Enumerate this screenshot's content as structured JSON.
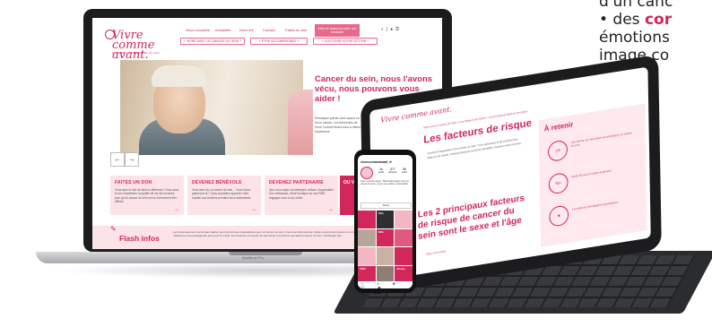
{
  "cropped_text": {
    "line1": "d'un canc",
    "line2_prefix": "• des ",
    "line2_bold": "cor",
    "line3": "émotions",
    "line4": "image co"
  },
  "laptop": {
    "brand_label": "MacBook Pro",
    "site": {
      "logo_title": "Vivre comme avant.",
      "logo_tagline": "Ensemble contre le cancer du sein",
      "nav": [
        "Nous connaître",
        "Actualités",
        "Nous lire",
        "Contact",
        "Faites un don"
      ],
      "nav_cta": "Vivre en ressource avec une bénévole",
      "subnav": [
        "+ VIVRE AVEC LE CANCER DU SEIN +",
        "+ ÊTRE ACCOMPAGNÉE +",
        "+ SOUTENIR NOTRE ACTION +"
      ],
      "hero_title": "Cancer du sein, nous l'avons vécu, nous pouvons vous aider !",
      "hero_text": "Remarque parfois dure quand on vit un cancer. Les bénévoles de Vivre Comme Avant vous à même expérience",
      "prev_arrow": "←",
      "next_arrow": "→",
      "cards": [
        {
          "title": "FAITES UN DON",
          "text": "Vous avez le don de faire la différence ! Vous avez le don d'améliorer la qualité de vie des femmes pour qui le cancer du sein est un événement très difficile."
        },
        {
          "title": "DEVENEZ BÉNÉVOLE",
          "text": "Vous avez eu un cancer du sein… Vous l'avez passé par là ? Vous souhaitez apporter votre soutien aux femmes pendant leurs traitements."
        },
        {
          "title": "DEVENEZ PARTENAIRE",
          "text": "Que vous soyez commerçant, artisan, responsable d'un restaurant, d'une boutique ou une PME, engagez-vous à nos côtés."
        }
      ],
      "card_arrow": "→",
      "card_pink_title": "OU V",
      "flash_title": "Flash infos",
      "flash_text": "Les bénévoles sont reconnues viables pour les femmes hospitalisées pour un cancer du sein. C'est une belle journée ! Elles ouvrent leurs parents et vous pour les médecins et les enseignants pour pour le Covid. Les femmes ont besoin de rencontrer une femme qui avait le cancer du sein, d'échanger leur."
    }
  },
  "tablet": {
    "logo": "Vivre comme avant.",
    "breadcrumb": "Vivre avec le cancer du sein  >  Les facteurs de risque  >  Les principaux facteurs de risque",
    "title": "Les facteurs de risque",
    "body": "Comment l'apparition d'un cancer du sein ? Ces questions et de nombreuses facteurs de risque. Certains facteurs sont bien identifiés, d'autres moins connus.",
    "h2": "Les 2 principaux facteurs de risque de cancer du sein sont le sexe et l'âge",
    "retenir_title": "À retenir",
    "retenir_items": [
      {
        "badge": "1/8",
        "text": "Une femme sur huit risque de développer un cancer du sein"
      },
      {
        "badge": "50+",
        "text": "Après 50 ans, le risque augmente"
      },
      {
        "badge": "✱",
        "text": "Les facteurs héréditaires et génétiques"
      }
    ],
    "bullet": "• Être une femme"
  },
  "phone": {
    "username": "vivrecommeavant_fr",
    "stats": [
      {
        "value": "1k",
        "label": "posts"
      },
      {
        "value": "577",
        "label": "abonnés"
      },
      {
        "value": "85",
        "label": "suivis"
      }
    ],
    "bio": "Vivre Comme Avant · Bénévoles ayant vécu un cancer du sein, nous vous aidons. Association",
    "button": "Suivre",
    "tiles": [
      {
        "text": "",
        "color": "#d2275a"
      },
      {
        "text": "40%",
        "color": "#2f2f33"
      },
      {
        "text": "",
        "color": "#f3b6c3"
      },
      {
        "text": "",
        "color": "#b7a59a"
      },
      {
        "text": "60%",
        "color": "#d2275a"
      },
      {
        "text": "",
        "color": "#e05a7f"
      },
      {
        "text": "",
        "color": "#f3b6c3"
      },
      {
        "text": "",
        "color": "#c9b2a4"
      },
      {
        "text": "",
        "color": "#d2275a"
      },
      {
        "text": "1500",
        "color": "#d2275a"
      },
      {
        "text": "",
        "color": "#8e7d74"
      },
      {
        "text": "20 ans",
        "color": "#d2275a"
      }
    ],
    "bottom_bar": "⌂ ⌕ ⊕ ♡ ◉"
  },
  "colors": {
    "brand": "#d2275a",
    "brand_light": "#fbe3e8"
  }
}
